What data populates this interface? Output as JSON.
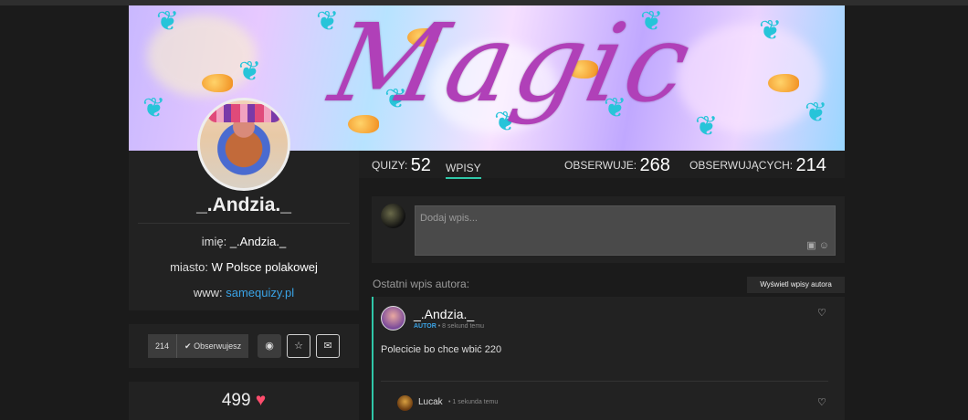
{
  "banner": {
    "title": "Magic"
  },
  "profile": {
    "username": "_.Andzia._",
    "info": [
      {
        "label": "imię:",
        "value": "_.Andzia._"
      },
      {
        "label": "miasto:",
        "value": "W Polsce polakowej"
      },
      {
        "label": "www:",
        "value": "samequizy.pl"
      }
    ],
    "followers_count": "214",
    "follow_label": "Obserwujesz",
    "likes": "499"
  },
  "stats": {
    "quizzes_label": "QUIZY:",
    "quizzes": "52",
    "posts_tab": "WPISY",
    "following_label": "OBSERWUJE:",
    "following": "268",
    "followers_label": "OBSERWUJĄCYCH:",
    "followers": "214"
  },
  "compose": {
    "placeholder": "Dodaj wpis..."
  },
  "recent": {
    "label": "Ostatni wpis autora:",
    "show_button": "Wyświetl wpisy autora"
  },
  "post": {
    "author": "_.Andzia._",
    "badge": "AUTOR",
    "time": "8 sekund temu",
    "text": "Polecicie bo chce wbić 220"
  },
  "reply": {
    "author": "Lucak",
    "time": "1 sekunda temu"
  },
  "colors": {
    "accent": "#2fc7a8",
    "link": "#3aa3e6",
    "heart": "#ff4d6d",
    "title": "#b040b8"
  }
}
